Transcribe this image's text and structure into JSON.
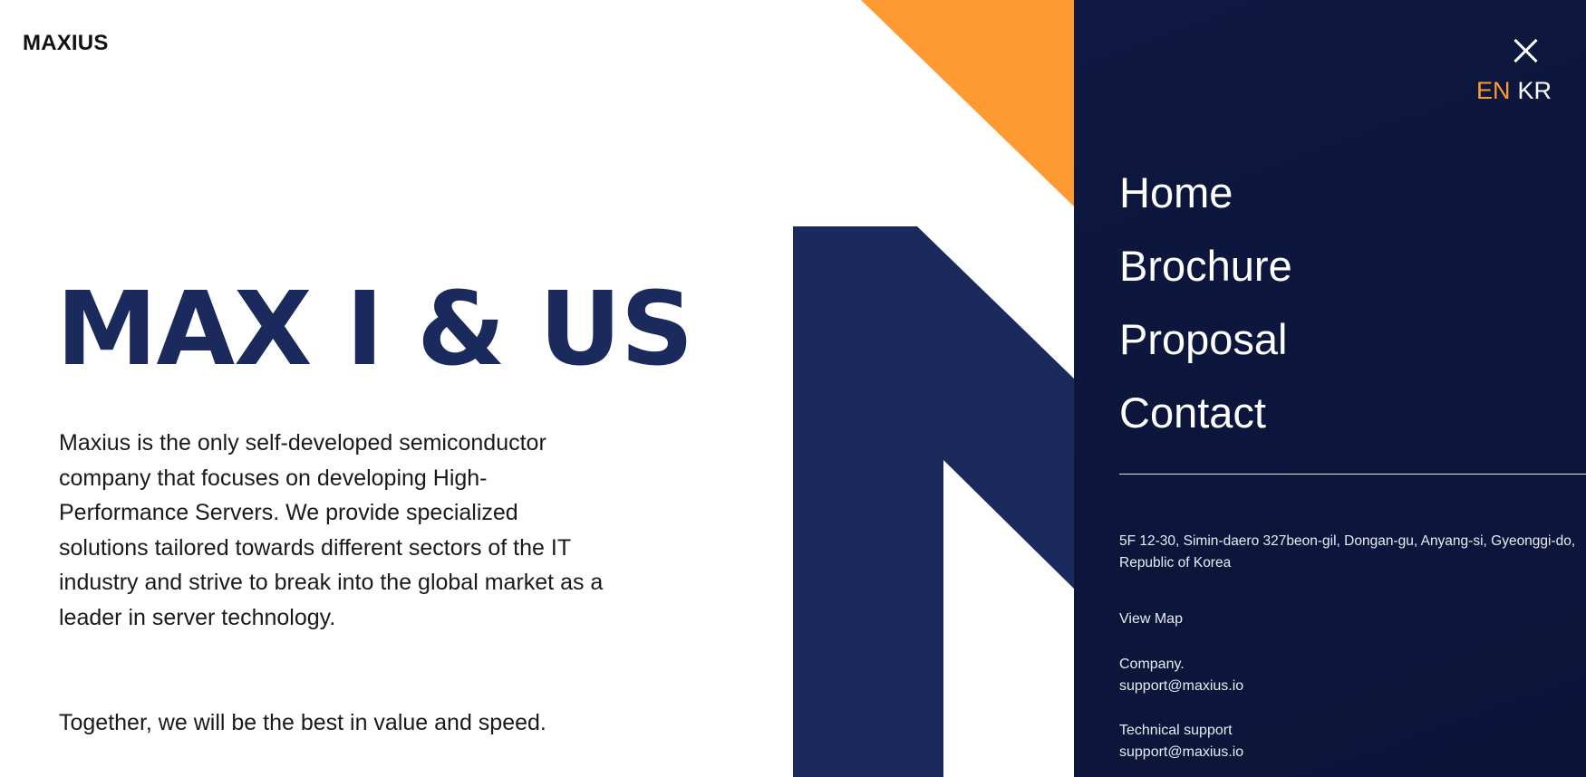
{
  "header": {
    "logo_text": "MAXIUS"
  },
  "hero": {
    "title": "MAX I & US",
    "description": "Maxius is the only self-developed semiconductor company that focuses on developing High-Performance Servers. We provide specialized solutions tailored towards different sectors of the IT industry and strive to break into the global market as a leader in server technology.",
    "tagline": "Together, we will be the best in value and speed."
  },
  "menu": {
    "close_icon": "close-icon",
    "languages": [
      {
        "label": "EN",
        "active": true
      },
      {
        "label": "KR",
        "active": false
      }
    ],
    "nav_items": [
      {
        "label": "Home"
      },
      {
        "label": "Brochure"
      },
      {
        "label": "Proposal"
      },
      {
        "label": "Contact"
      }
    ],
    "address": "5F 12-30, Simin-daero 327beon-gil, Dongan-gu, Anyang-si, Gyeonggi-do, Republic of Korea",
    "view_map": "View Map",
    "company": {
      "label": "Company.",
      "email": "support@maxius.io"
    },
    "technical": {
      "label": "Technical support",
      "email": "support@maxius.io"
    }
  },
  "colors": {
    "brand_navy": "#1b2a5c",
    "drawer_bg": "#0e1840",
    "accent_orange": "#ff9a33",
    "active_language": "#ff9a33"
  }
}
